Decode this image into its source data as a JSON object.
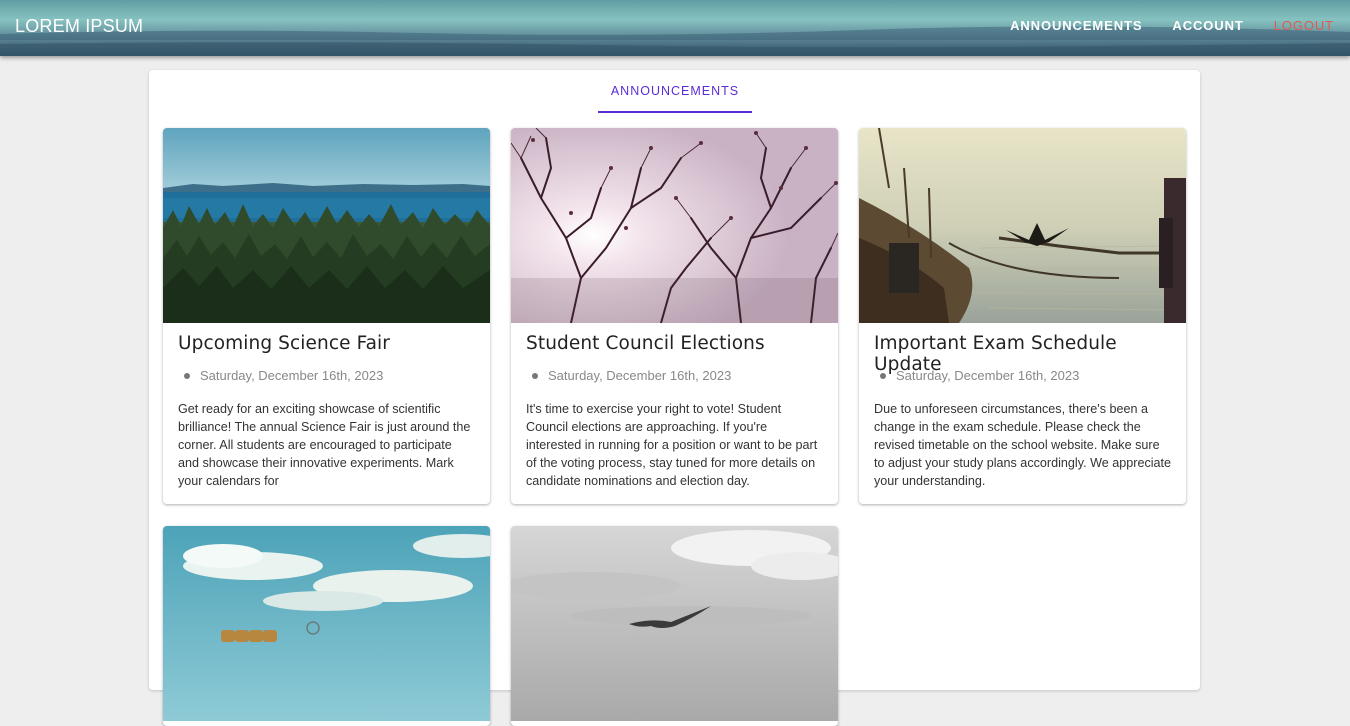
{
  "header": {
    "brand": "LOREM IPSUM",
    "nav": {
      "announcements": "ANNOUNCEMENTS",
      "account": "ACCOUNT",
      "logout": "LOGOUT"
    }
  },
  "tabs": {
    "active": "ANNOUNCEMENTS"
  },
  "cards": [
    {
      "title": "Upcoming Science Fair",
      "date": "Saturday, December 16th, 2023",
      "description": "Get ready for an exciting showcase of scientific brilliance! The annual Science Fair is just around the corner. All students are encouraged to participate and showcase their innovative experiments. Mark your calendars for",
      "image": "forest-lake-photo"
    },
    {
      "title": "Student Council Elections",
      "date": "Saturday, December 16th, 2023",
      "description": "It's time to exercise your right to vote! Student Council elections are approaching. If you're interested in running for a position or want to be part of the voting process, stay tuned for more details on candidate nominations and election day.",
      "image": "tree-branches-photo"
    },
    {
      "title": "Important Exam Schedule Update",
      "date": "Saturday, December 16th, 2023",
      "description": "Due to unforeseen circumstances, there's been a change in the exam schedule. Please check the revised timetable on the school website. Make sure to adjust your study plans accordingly. We appreciate your understanding.",
      "image": "boat-bird-photo"
    },
    {
      "image": "sky-field-photo"
    },
    {
      "image": "gull-cloudy-sky-photo"
    }
  ],
  "colors": {
    "accent": "#5b2bd6",
    "logout": "#e05a4f",
    "page_bg": "#eeeeee"
  }
}
